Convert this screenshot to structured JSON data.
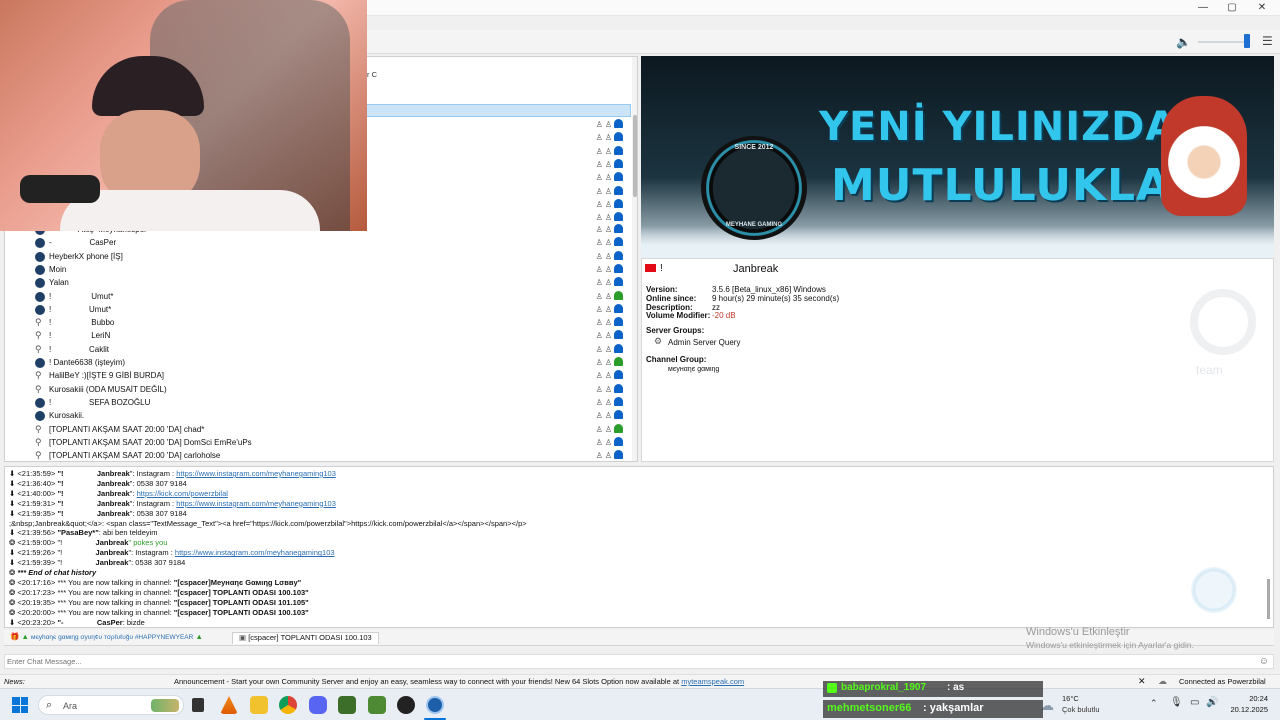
{
  "window": {
    "minimize": "—",
    "maximize": "▢",
    "close": "✕"
  },
  "toolbar": {
    "volume_icon": "speaker-icon",
    "fragment_1": "r C",
    "fragment_2": ""
  },
  "tree": {
    "rows": [
      {
        "icon": "dot",
        "name": "-            Ateş  Meyhanespor",
        "flags": "⚑⚑"
      },
      {
        "icon": "dot",
        "name": "-                 CasPer",
        "flags": "⚑⚑⚑⚑"
      },
      {
        "icon": "dot",
        "name": "HeyberkX phone [İŞ]",
        "flags": "⚑⚑"
      },
      {
        "icon": "dot",
        "name": "Moin",
        "flags": "⚑⚑"
      },
      {
        "icon": "dot",
        "name": "Yalan",
        "flags": "⚑⚑"
      },
      {
        "icon": "dot",
        "name": "!                  Umut*",
        "flags": "⚑⚑"
      },
      {
        "icon": "dot",
        "name": "!                 Umut*",
        "flags": "⚑⚑"
      },
      {
        "icon": "person",
        "name": "!                  Bubbo",
        "flags": "⚑⚑"
      },
      {
        "icon": "person",
        "name": "!                  LeriN",
        "flags": "⚑⚑"
      },
      {
        "icon": "person",
        "name": "!                 Caklit",
        "flags": "⚑⚑"
      },
      {
        "icon": "dot",
        "name": "! Dante6638 (işteyim)",
        "flags": "⚑⚑"
      },
      {
        "icon": "person",
        "name": "HalilBeY :)[İŞTE 9 GİBİ BURDA]",
        "flags": "⚑⚑"
      },
      {
        "icon": "person",
        "name": "Kurosakiii (ODA MUSAİT DEĞİL)",
        "flags": "⚑⚑"
      },
      {
        "icon": "dot",
        "name": "!                 SEFA BOZOĞLU",
        "flags": "⚑⚑"
      },
      {
        "icon": "dot",
        "name": "Kurosakii.",
        "flags": "⚑⚑"
      },
      {
        "icon": "person",
        "name": "[TOPLANTI AKŞAM SAAT 20:00 'DA] chad*",
        "flags": "⚑⚑"
      },
      {
        "icon": "person",
        "name": "[TOPLANTI AKŞAM SAAT 20:00 'DA] DomSci EmRe'uPs",
        "flags": "⚑⚑"
      },
      {
        "icon": "person",
        "name": "[TOPLANTI AKŞAM SAAT 20:00 'DA] carloholse",
        "flags": "⚑⚑"
      }
    ]
  },
  "banner": {
    "line1": "YENİ YILINIZDA",
    "line2": "MUTLULUKLAR",
    "logo_top": "SINCE 2012",
    "logo_bottom": "MEYHANE GAMING"
  },
  "info": {
    "prefix": "!",
    "nickname": "Janbreak",
    "version_label": "Version:",
    "version_value": "3.5.6 [Beta_linux_x86] Windows",
    "online_label": "Online since:",
    "online_value": "9 hour(s) 29 minute(s) 35 second(s)",
    "description_label": "Description:",
    "description_value": "zz",
    "volume_label": "Volume Modifier:",
    "volume_value": "-20 dB",
    "server_groups_label": "Server Groups:",
    "server_group": "Admin Server Query",
    "channel_group_label": "Channel Group:",
    "channel_group": "мєунαηє gαмιηg",
    "watermark": "team"
  },
  "chat": [
    {
      "time": "<21:35:59>",
      "pre": "\"!",
      "nick": "Janbreak",
      "text": "\": Instagram : ",
      "link": "https://www.instagram.com/meyhanegaming103"
    },
    {
      "time": "<21:36:40>",
      "pre": "\"!",
      "nick": "Janbreak",
      "text": "\": 0538 307 9184",
      "link": ""
    },
    {
      "time": "<21:40:00>",
      "pre": "\"!",
      "nick": "Janbreak",
      "text": "\": ",
      "link": "https://kick.com/powerzbilal"
    },
    {
      "time": "<21:59:31>",
      "pre": "\"!",
      "nick": "Janbreak",
      "text": "\": Instagram : ",
      "link": "https://www.instagram.com/meyhanegaming103"
    },
    {
      "time": "<21:59:35>",
      "pre": "\"!",
      "nick": "Janbreak",
      "text": "\": 0538 307 9184",
      "link": ""
    }
  ],
  "chat_raw": ";&nbsp;Janbreak&quot;</a>: <span class=\"TextMessage_Text\"><a href=\"https://kick.com/powerzbilal\">https://kick.com/powerzbilal</a></span></span></p>",
  "chat2": [
    {
      "time": "<21:39:56>",
      "nick": "\"PasaBey*\"",
      "text": ": abi ben teldeyim"
    },
    {
      "time": "<21:59:00>",
      "nick": "Janbreak",
      "text": "\" pokes you"
    },
    {
      "time": "<21:59:26>",
      "nick": "Janbreak",
      "text": "\": Instagram : ",
      "link": "https://www.instagram.com/meyhanegaming103"
    },
    {
      "time": "<21:59:39>",
      "nick": "Janbreak",
      "text": "\": 0538 307 9184"
    }
  ],
  "history_end": "*** End of chat history",
  "system": [
    {
      "time": "<20:17:16>",
      "text": "*** You are now talking in channel: ",
      "ch": "\"[cspacer]Meyнαηє Gαмιηg Lσввy\""
    },
    {
      "time": "<20:17:23>",
      "text": "*** You are now talking in channel: ",
      "ch": "\"[cspacer] TOPLANTI ODASI 100.103\""
    },
    {
      "time": "<20:19:35>",
      "text": "*** You are now talking in channel: ",
      "ch": "\"[cspacer] TOPLANTI ODASI 101.105\""
    },
    {
      "time": "<20:20:00>",
      "text": "*** You are now talking in channel: ",
      "ch": "\"[cspacer] TOPLANTI ODASI 100.103\""
    }
  ],
  "last_line": {
    "time": "<20:23:20>",
    "pre": "\"-",
    "nick": "CasPer",
    "text": ": bizde"
  },
  "tabs": [
    {
      "label": "мєуhαηє gαмιηg σуυη¢υ тσρℓυℓυğυ #HAPPYNEWYEAR"
    },
    {
      "label": "[cspacer] TOPLANTI ODASI 100.103"
    }
  ],
  "input_placeholder": "Enter Chat Message...",
  "news": {
    "label": "News:",
    "text": "Announcement - Start your own Community Server and enjoy an easy, seamless way to connect with your friends! New 64 Slots Option now available at ",
    "link": "myteamspeak.com",
    "connected": "Connected as Powerzbilal"
  },
  "activation": {
    "line1": "Windows'u Etkinleştir",
    "line2": "Windows'u etkinleştirmek için Ayarlar'a gidin."
  },
  "stream_overlay": [
    {
      "user": "babaprokral_1907",
      "msg": ": as"
    },
    {
      "user": "mehmetsoner66",
      "msg": ": yakşamlar"
    }
  ],
  "taskbar": {
    "search": "Ara",
    "weather_temp": "16°C",
    "weather_desc": "Çok bulutlu",
    "time": "20:24",
    "date": "20.12.2025"
  }
}
